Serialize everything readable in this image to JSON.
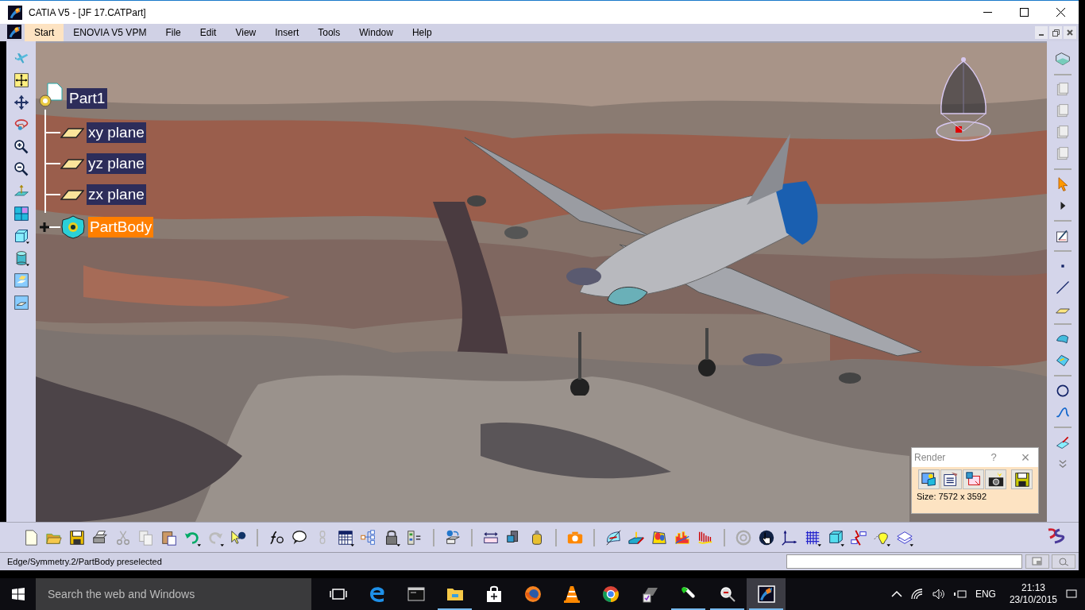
{
  "window": {
    "title": "CATIA V5 - [JF 17.CATPart]"
  },
  "menu": [
    {
      "label": "Start",
      "highlighted": true
    },
    {
      "label": "ENOVIA V5 VPM",
      "highlighted": false
    },
    {
      "label": "File",
      "highlighted": false
    },
    {
      "label": "Edit",
      "highlighted": false
    },
    {
      "label": "View",
      "highlighted": false
    },
    {
      "label": "Insert",
      "highlighted": false
    },
    {
      "label": "Tools",
      "highlighted": false
    },
    {
      "label": "Window",
      "highlighted": false
    },
    {
      "label": "Help",
      "highlighted": false
    }
  ],
  "tree": {
    "label": "Part1",
    "children": [
      {
        "label": "xy plane",
        "kind": "plane",
        "selected": false
      },
      {
        "label": "yz plane",
        "kind": "plane",
        "selected": false
      },
      {
        "label": "zx plane",
        "kind": "plane",
        "selected": false
      },
      {
        "label": "PartBody",
        "kind": "body",
        "selected": true
      }
    ]
  },
  "render_dialog": {
    "title": "Render",
    "help": "?",
    "close": "×",
    "size": "Size: 7572 x 3592"
  },
  "status_bar": {
    "message": "Edge/Symmetry.2/PartBody preselected"
  },
  "taskbar": {
    "search_placeholder": "Search the web and Windows",
    "language": "ENG",
    "time": "21:13",
    "date": "23/10/2015",
    "apps": [
      {
        "kind": "taskview",
        "running": false,
        "selected": false
      },
      {
        "kind": "edge",
        "running": false,
        "selected": false
      },
      {
        "kind": "cmd",
        "running": false,
        "selected": false
      },
      {
        "kind": "folder",
        "running": true,
        "selected": false
      },
      {
        "kind": "store",
        "running": false,
        "selected": false
      },
      {
        "kind": "firefox",
        "running": false,
        "selected": false
      },
      {
        "kind": "vlc",
        "running": false,
        "selected": false
      },
      {
        "kind": "chrome",
        "running": false,
        "selected": false
      },
      {
        "kind": "notebook",
        "running": false,
        "selected": false
      },
      {
        "kind": "pill",
        "running": true,
        "selected": false
      },
      {
        "kind": "magnifier",
        "running": true,
        "selected": false
      },
      {
        "kind": "catia",
        "running": true,
        "selected": true
      }
    ]
  }
}
